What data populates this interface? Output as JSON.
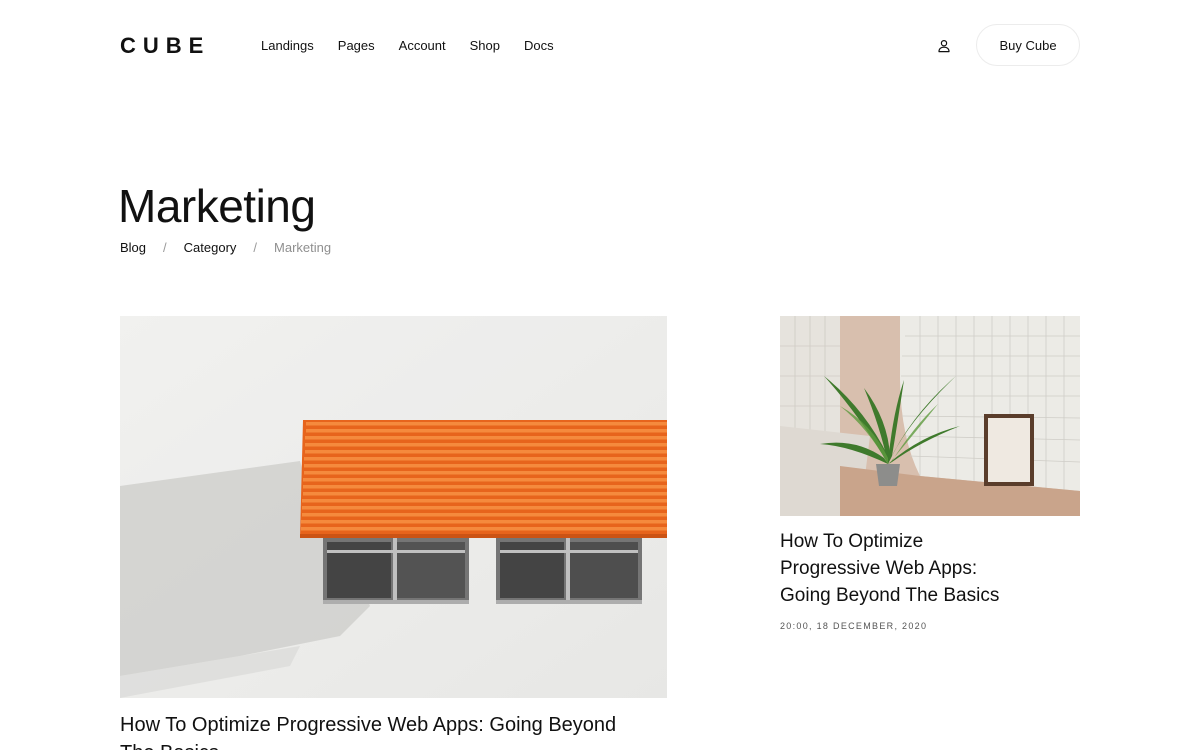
{
  "brand": {
    "logo": "CUBE"
  },
  "nav": {
    "items": [
      {
        "label": "Landings"
      },
      {
        "label": "Pages"
      },
      {
        "label": "Account"
      },
      {
        "label": "Shop"
      },
      {
        "label": "Docs"
      }
    ],
    "user_icon": "user-icon",
    "buy_label": "Buy Cube"
  },
  "page": {
    "title": "Marketing",
    "breadcrumb": {
      "items": [
        {
          "label": "Blog"
        },
        {
          "label": "Category"
        },
        {
          "label": "Marketing"
        }
      ],
      "separator": "/"
    }
  },
  "posts": {
    "featured": {
      "title": "How To Optimize Progressive Web Apps: Going Beyond The Basics",
      "image": "orange-awning-building-photo"
    },
    "side": {
      "title": "How To Optimize Progressive Web Apps: Going Beyond The Basics",
      "meta": "20:00, 18 DECEMBER, 2020",
      "image": "plant-in-tiled-room-photo"
    }
  },
  "colors": {
    "text": "#111111",
    "muted": "#8f8f8f",
    "awning": "#f26a1b",
    "wall": "#ececea"
  }
}
